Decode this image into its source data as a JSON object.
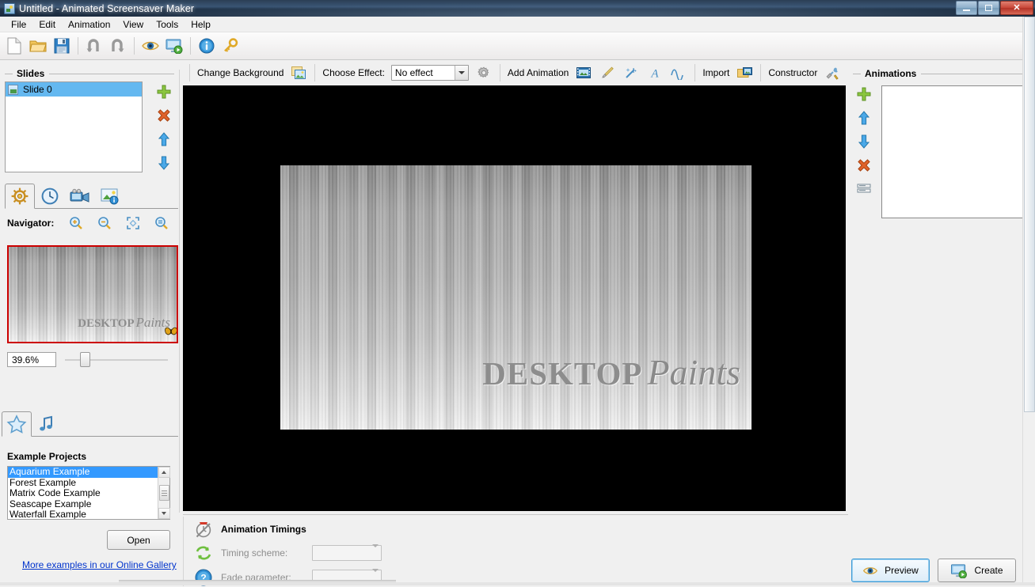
{
  "window": {
    "title": "Untitled - Animated Screensaver Maker",
    "icon": "app-icon",
    "buttons": {
      "minimize": "minimize",
      "maximize": "maximize",
      "close": "close"
    }
  },
  "menubar": {
    "items": [
      {
        "label": "File"
      },
      {
        "label": "Edit"
      },
      {
        "label": "Animation"
      },
      {
        "label": "View"
      },
      {
        "label": "Tools"
      },
      {
        "label": "Help"
      }
    ]
  },
  "toolbar": {
    "buttons": [
      {
        "name": "new-icon",
        "tooltip": "New"
      },
      {
        "name": "open-folder-icon",
        "tooltip": "Open"
      },
      {
        "name": "save-disk-icon",
        "tooltip": "Save"
      },
      {
        "name": "undo-icon",
        "tooltip": "Undo"
      },
      {
        "name": "redo-icon",
        "tooltip": "Redo"
      },
      {
        "name": "preview-eye-icon",
        "tooltip": "Preview"
      },
      {
        "name": "create-screen-icon",
        "tooltip": "Create"
      },
      {
        "name": "info-icon",
        "tooltip": "About"
      },
      {
        "name": "key-icon",
        "tooltip": "Registration"
      }
    ]
  },
  "toolbar2": {
    "change_background_label": "Change Background",
    "choose_effect_label": "Choose Effect:",
    "effect_value": "No effect",
    "add_animation_label": "Add Animation",
    "import_label": "Import",
    "constructor_label": "Constructor"
  },
  "slides_panel": {
    "title": "Slides",
    "items": [
      {
        "label": "Slide 0",
        "selected": true
      }
    ],
    "buttons": [
      {
        "name": "add-slide-button",
        "glyph": "plus"
      },
      {
        "name": "delete-slide-button",
        "glyph": "cross"
      },
      {
        "name": "move-slide-up-button",
        "glyph": "up"
      },
      {
        "name": "move-slide-down-button",
        "glyph": "down"
      }
    ]
  },
  "left_tabs": [
    {
      "name": "tab-general",
      "icon": "ships-wheel-icon",
      "active": true
    },
    {
      "name": "tab-timing",
      "icon": "clock-icon",
      "active": false
    },
    {
      "name": "tab-video",
      "icon": "camcorder-icon",
      "active": false
    },
    {
      "name": "tab-image-info",
      "icon": "picture-info-icon",
      "active": false
    }
  ],
  "navigator": {
    "label": "Navigator:",
    "buttons": [
      {
        "name": "zoom-in-button",
        "icon": "magnifier-plus-icon"
      },
      {
        "name": "zoom-out-button",
        "icon": "magnifier-minus-icon"
      },
      {
        "name": "fit-to-window-button",
        "icon": "fit-frame-icon"
      },
      {
        "name": "actual-size-button",
        "icon": "magnifier-equal-icon"
      }
    ],
    "zoom_value": "39.6%",
    "slider_position_percent": 16
  },
  "example_panel": {
    "tabs": [
      {
        "name": "tab-example-projects",
        "icon": "star-icon",
        "active": true
      },
      {
        "name": "tab-music",
        "icon": "music-note-icon",
        "active": false
      }
    ],
    "title": "Example Projects",
    "items": [
      {
        "label": "Aquarium Example",
        "selected": true
      },
      {
        "label": "Forest Example",
        "selected": false
      },
      {
        "label": "Matrix Code Example",
        "selected": false
      },
      {
        "label": "Seascape Example",
        "selected": false
      },
      {
        "label": "Waterfall Example",
        "selected": false
      }
    ],
    "open_button": "Open",
    "gallery_link": "More examples in our Online Gallery"
  },
  "canvas": {
    "brand_word1": "DESKTOP",
    "brand_word2": "Paints",
    "butterfly": "butterfly-icon"
  },
  "timings": {
    "title": "Animation Timings",
    "title_icon": "timings-disabled-icon",
    "rows": [
      {
        "icon": "refresh-arrows-icon",
        "label": "Timing scheme:",
        "value": ""
      },
      {
        "icon": "question-mark-icon",
        "label": "Fade parameter:",
        "value": ""
      }
    ]
  },
  "animations_panel": {
    "title": "Animations",
    "items": [],
    "buttons": [
      {
        "name": "add-animation-button",
        "glyph": "plus"
      },
      {
        "name": "move-animation-up-button",
        "glyph": "up"
      },
      {
        "name": "move-animation-down-button",
        "glyph": "down"
      },
      {
        "name": "delete-animation-button",
        "glyph": "cross"
      },
      {
        "name": "animation-list-button",
        "glyph": "list"
      }
    ]
  },
  "actions": {
    "preview_label": "Preview",
    "create_label": "Create"
  },
  "colors": {
    "titlebar": "#2b3f55",
    "selection": "#3399ff",
    "slide_selection": "#64b8f0",
    "navigator_border": "#cc0000",
    "link": "#0033cc",
    "panel_bg": "#f0f0f0",
    "close_button": "#c9483a"
  }
}
